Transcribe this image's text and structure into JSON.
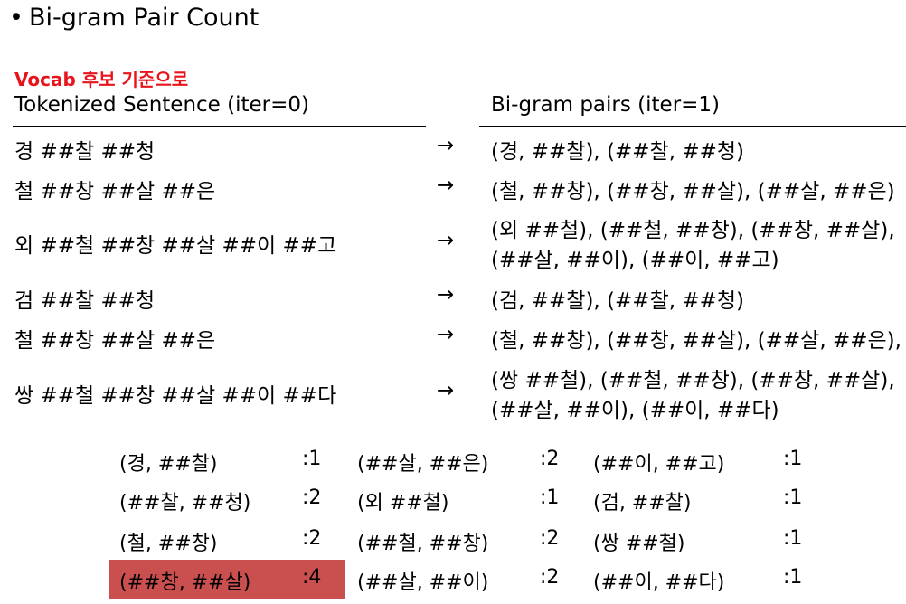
{
  "title": "Bi-gram Pair Count",
  "subtitle": "Vocab 후보 기준으로",
  "headers": {
    "left": "Tokenized Sentence (iter=0)",
    "right": "Bi-gram pairs (iter=1)"
  },
  "arrow_symbol": "→",
  "rows": [
    {
      "sentence": "경 ##찰 ##청",
      "pairs": [
        "(경, ##찰), (##찰, ##청)"
      ]
    },
    {
      "sentence": "철 ##창 ##살 ##은",
      "pairs": [
        "(철, ##창), (##창, ##살), (##살, ##은)"
      ]
    },
    {
      "sentence": "외 ##철 ##창 ##살 ##이 ##고",
      "pairs": [
        "(외 ##철), (##철, ##창), (##창, ##살),",
        "(##살, ##이), (##이, ##고)"
      ]
    },
    {
      "sentence": "검 ##찰 ##청",
      "pairs": [
        "(검, ##찰), (##찰, ##청)"
      ]
    },
    {
      "sentence": "철 ##창 ##살 ##은",
      "pairs": [
        "(철, ##창), (##창, ##살), (##살, ##은),"
      ]
    },
    {
      "sentence": "쌍 ##철 ##창 ##살 ##이 ##다",
      "pairs": [
        "(쌍 ##철), (##철, ##창), (##창, ##살),",
        "(##살, ##이), (##이, ##다)"
      ]
    }
  ],
  "counts": [
    [
      {
        "pair": "(경, ##찰)",
        "count": ":1"
      },
      {
        "pair": "(##살, ##은)",
        "count": ":2"
      },
      {
        "pair": "(##이, ##고)",
        "count": ":1"
      }
    ],
    [
      {
        "pair": "(##찰, ##청)",
        "count": ":2"
      },
      {
        "pair": "(외 ##철)",
        "count": ":1"
      },
      {
        "pair": "(검, ##찰)",
        "count": ":1"
      }
    ],
    [
      {
        "pair": "(철, ##창)",
        "count": ":2"
      },
      {
        "pair": "(##철, ##창)",
        "count": ":2"
      },
      {
        "pair": "(쌍 ##철)",
        "count": ":1"
      }
    ],
    [
      {
        "pair": "(##창, ##살)",
        "count": ":4"
      },
      {
        "pair": "(##살, ##이)",
        "count": ":2"
      },
      {
        "pair": "(##이, ##다)",
        "count": ":1"
      }
    ]
  ],
  "colors": {
    "subtitle": "#e8141c",
    "highlight": "#c9504f",
    "text": "#000000"
  }
}
